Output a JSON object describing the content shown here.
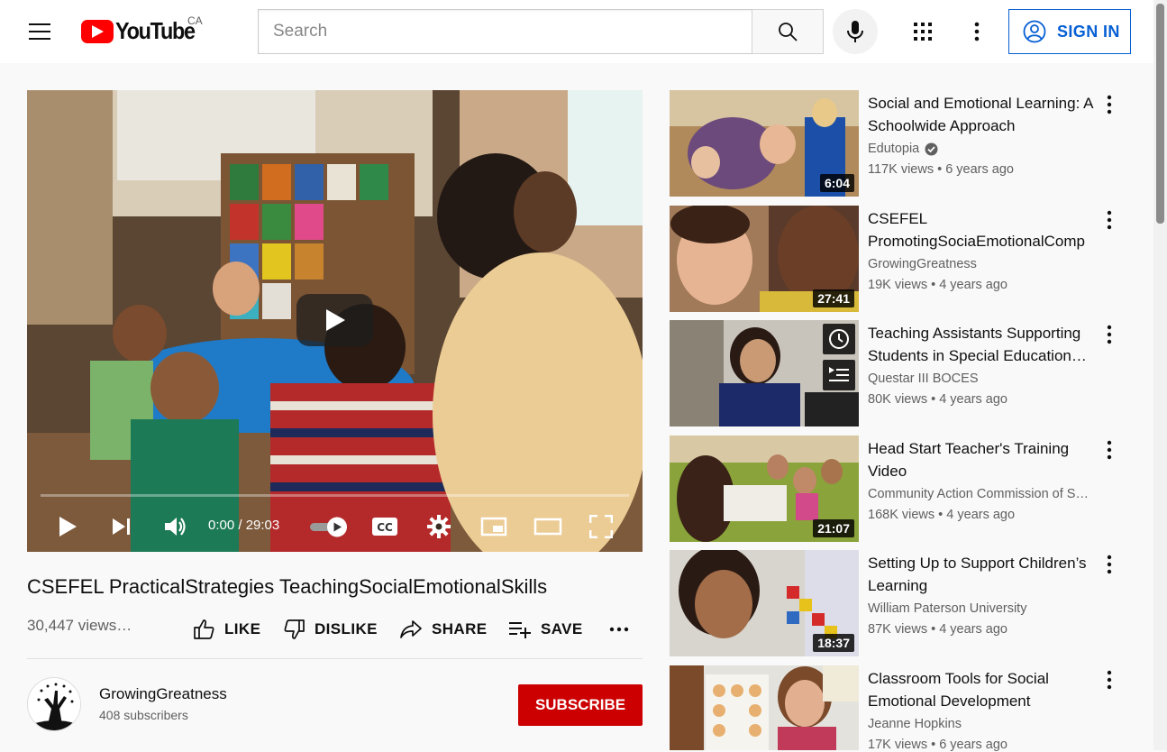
{
  "header": {
    "logo_text": "YouTube",
    "country": "CA",
    "search_placeholder": "Search",
    "sign_in": "SIGN IN"
  },
  "player": {
    "time": "0:00 / 29:03",
    "progress": 0
  },
  "video": {
    "title": "CSEFEL PracticalStrategies TeachingSocialEmotionalSkills",
    "views": "30,447 views…",
    "like": "LIKE",
    "dislike": "DISLIKE",
    "share": "SHARE",
    "save": "SAVE"
  },
  "channel": {
    "name": "GrowingGreatness",
    "subscribers": "408 subscribers",
    "subscribe": "SUBSCRIBE"
  },
  "recommendations": [
    {
      "title": "Social and Emotional Learning: A Schoolwide Approach",
      "channel": "Edutopia",
      "verified": true,
      "meta": "117K views • 6 years ago",
      "duration": "6:04"
    },
    {
      "title": "CSEFEL PromotingSociaEmotionalComp",
      "channel": "GrowingGreatness",
      "verified": false,
      "meta": "19K views • 4 years ago",
      "duration": "27:41"
    },
    {
      "title": "Teaching Assistants Supporting Students in Special Education…",
      "channel": "Questar III BOCES",
      "verified": false,
      "meta": "80K views • 4 years ago",
      "duration": ""
    },
    {
      "title": "Head Start Teacher's Training Video",
      "channel": "Community Action Commission of S…",
      "verified": false,
      "meta": "168K views • 4 years ago",
      "duration": "21:07"
    },
    {
      "title": "Setting Up to Support Children’s Learning",
      "channel": "William Paterson University",
      "verified": false,
      "meta": "87K views • 4 years ago",
      "duration": "18:37"
    },
    {
      "title": "Classroom Tools for Social Emotional Development",
      "channel": "Jeanne Hopkins",
      "verified": false,
      "meta": "17K views • 6 years ago",
      "duration": ""
    }
  ],
  "colors": {
    "brand_red": "#ff0000",
    "subscribe_red": "#cc0000",
    "link_blue": "#065fd4"
  }
}
